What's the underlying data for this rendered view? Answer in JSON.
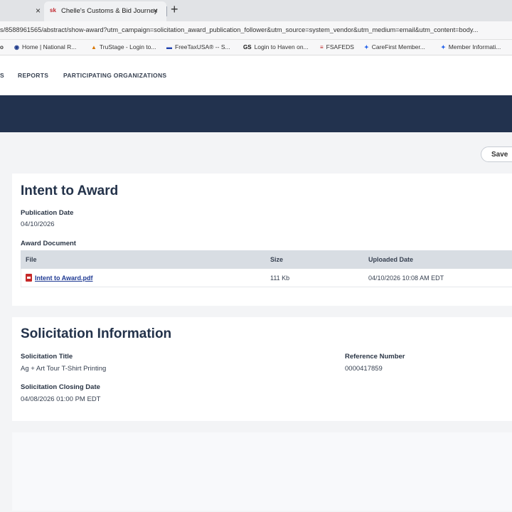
{
  "browser": {
    "tab_close_prev": "×",
    "active_tab": {
      "favicon": "sk",
      "title": "Chelle's Customs & Bid Journey",
      "close": "×"
    },
    "new_tab": "+",
    "url": "s/8588961565/abstract/show-award?utm_campaign=solicitation_award_publication_follower&utm_source=system_vendor&utm_medium=email&utm_content=body...",
    "bookmarks": [
      {
        "icon": "o",
        "label": ""
      },
      {
        "icon": "◉",
        "label": "Home | National R..."
      },
      {
        "icon": "▲",
        "label": "TruStage - Login to..."
      },
      {
        "icon": "▬",
        "label": "FreeTaxUSA® -- S..."
      },
      {
        "icon": "GS",
        "label": "Login to Haven on..."
      },
      {
        "icon": "≡",
        "label": "FSAFEDS"
      },
      {
        "icon": "✦",
        "label": "CareFirst Member..."
      },
      {
        "icon": "✦",
        "label": "Member Informati..."
      }
    ]
  },
  "nav": {
    "items": [
      "S",
      "REPORTS",
      "PARTICIPATING ORGANIZATIONS"
    ]
  },
  "actions": {
    "save_label": "Save"
  },
  "award": {
    "title": "Intent to Award",
    "publication_date_label": "Publication Date",
    "publication_date": "04/10/2026",
    "award_document_label": "Award Document",
    "columns": {
      "file": "File",
      "size": "Size",
      "uploaded": "Uploaded Date"
    },
    "files": [
      {
        "name": "Intent to Award.pdf",
        "size": "111 Kb",
        "uploaded": "04/10/2026 10:08 AM EDT"
      }
    ]
  },
  "solicitation": {
    "title": "Solicitation Information",
    "sol_title_label": "Solicitation Title",
    "sol_title": "Ag + Art Tour T-Shirt Printing",
    "reference_label": "Reference Number",
    "reference": "0000417859",
    "closing_label": "Solicitation Closing Date",
    "closing": "04/08/2026 01:00 PM EDT"
  },
  "colors": {
    "banner": "#22324e",
    "heading": "#23324a",
    "link": "#1f3a93",
    "pdf": "#c62828"
  }
}
